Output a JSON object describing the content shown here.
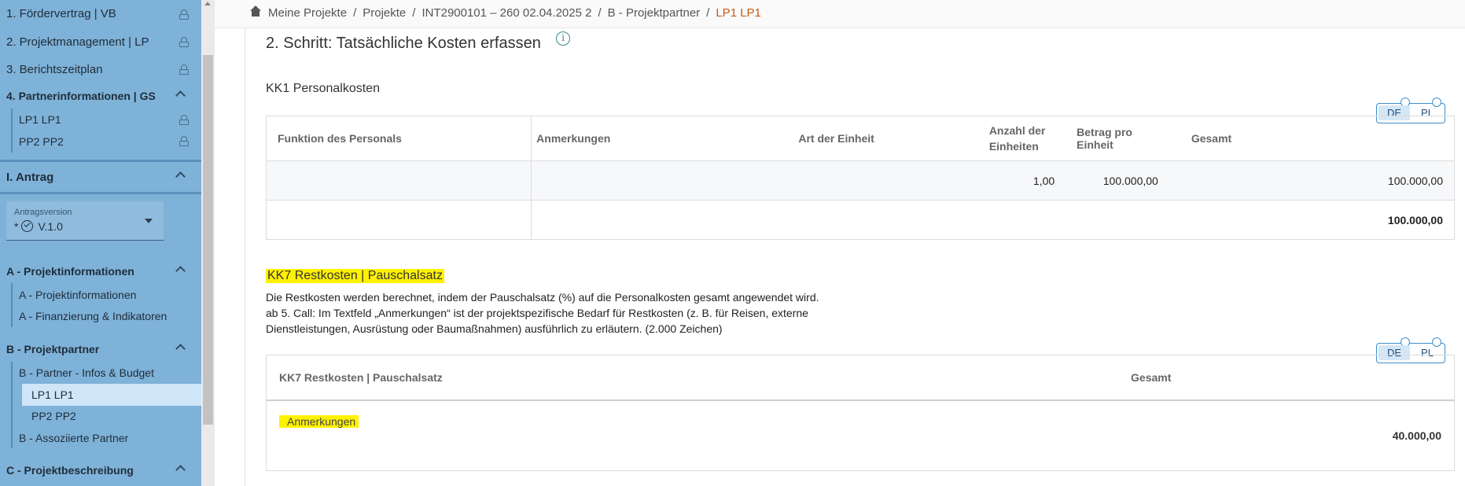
{
  "sidebar": {
    "items": [
      {
        "label": "1. Fördervertrag | VB"
      },
      {
        "label": "2. Projektmanagement | LP"
      },
      {
        "label": "3. Berichtszeitplan"
      },
      {
        "label": "4. Partnerinformationen | GS"
      },
      {
        "label": "LP1 LP1"
      },
      {
        "label": "PP2 PP2"
      },
      {
        "label": "I. Antrag"
      },
      {
        "label": "A - Projektinformationen"
      },
      {
        "label": "A - Projektinformationen"
      },
      {
        "label": "A - Finanzierung & Indikatoren"
      },
      {
        "label": "B - Projektpartner"
      },
      {
        "label": "B - Partner - Infos & Budget"
      },
      {
        "label": "LP1 LP1"
      },
      {
        "label": "PP2 PP2"
      },
      {
        "label": "B - Assoziierte Partner"
      },
      {
        "label": "C - Projektbeschreibung"
      }
    ],
    "version": {
      "label": "Antragsversion",
      "prefix": "*",
      "value": "V.1.0"
    }
  },
  "breadcrumb": {
    "items": [
      "Meine Projekte",
      "Projekte",
      "INT2900101 – 260 02.04.2025 2",
      "B - Projektpartner"
    ],
    "current": "LP1 LP1",
    "separator": "/"
  },
  "step": {
    "title": "2. Schritt: Tatsächliche Kosten erfassen",
    "info": "i"
  },
  "lang_toggle": {
    "de": "DE",
    "pl": "PL"
  },
  "kk1": {
    "title": "KK1 Personalkosten",
    "headers": [
      "Funktion des Personals",
      "Anmerkungen",
      "Art der Einheit",
      "Anzahl der Einheiten",
      "Betrag pro Einheit",
      "Gesamt"
    ],
    "row": {
      "function": "",
      "notes": "",
      "unit_type": "",
      "count": "1,00",
      "amount": "100.000,00",
      "total": "100.000,00"
    },
    "sum": "100.000,00"
  },
  "kk7": {
    "title": "KK7 Restkosten | Pauschalsatz",
    "desc_1": "Die Restkosten werden berechnet, indem der Pauschalsatz (%) auf die Personalkosten gesamt angewendet wird.",
    "desc_2": "ab 5. Call: Im Textfeld „Anmerkungen“ ist der projektspezifische Bedarf für Restkosten (z. B. für Reisen, externe Dienstleistungen, Ausrüstung oder Baumaßnahmen) ausführlich zu erläutern. (2.000 Zeichen)",
    "headers": [
      "KK7 Restkosten | Pauschalsatz",
      "Gesamt"
    ],
    "notes_label": "Anmerkungen",
    "total": "40.000,00"
  },
  "colors": {
    "sidebar": "#7fb2d8",
    "selected": "#cfe6f8",
    "highlight": "#fff200",
    "accent": "#c85a12",
    "toggle": "#3a8fd0"
  }
}
